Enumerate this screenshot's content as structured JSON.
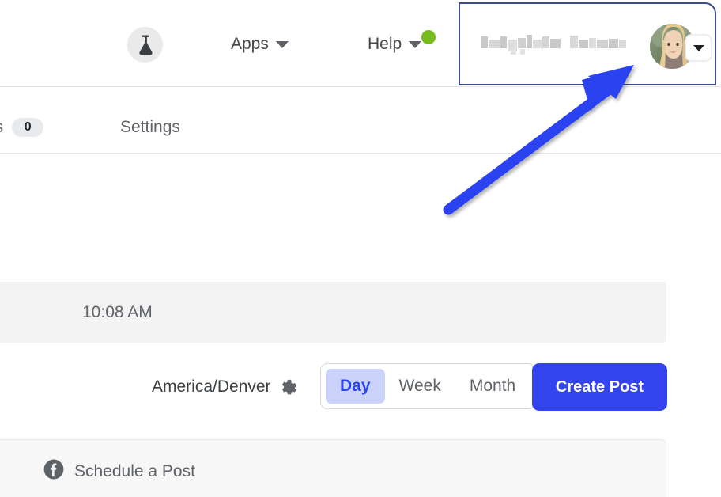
{
  "topnav": {
    "lab_icon": "flask-icon",
    "apps": {
      "label": "Apps",
      "icon": "chevron-down-icon"
    },
    "help": {
      "label": "Help",
      "icon": "chevron-down-icon",
      "status_dot_color": "#77bc1f"
    },
    "account": {
      "name_redacted": true,
      "name": "",
      "avatar_alt": "user-avatar-photo",
      "caret_icon": "chevron-down-icon"
    }
  },
  "tabbar": {
    "tabs": [
      {
        "label": "fts",
        "badge": "0",
        "name": "drafts"
      },
      {
        "label": "Settings",
        "badge": null,
        "name": "settings"
      }
    ]
  },
  "toolbar": {
    "timezone": "America/Denver",
    "timezone_settings_icon": "gear-icon",
    "view_options": [
      "Day",
      "Week",
      "Month"
    ],
    "view_selected": "Day",
    "create_post_label": "Create Post"
  },
  "calendar": {
    "slots": [
      {
        "time": "10:08 AM"
      }
    ]
  },
  "bottom": {
    "platform_icon": "facebook-icon",
    "schedule_label": "Schedule a Post"
  },
  "annotation": {
    "arrow_color": "#2b42f0",
    "highlight_color": "#3d4b8f"
  },
  "colors": {
    "primary_blue": "#3344ee",
    "active_pill": "#ccd3fb",
    "active_text": "#2b42f0",
    "status_green": "#77bc1f",
    "band_gray": "#f3f3f3"
  }
}
